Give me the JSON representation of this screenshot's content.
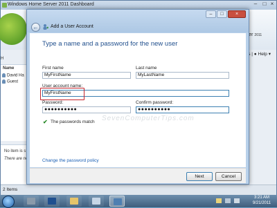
{
  "background_app": {
    "title": "Windows Home Server 2011 Dashboard",
    "home_label": "H",
    "brand": "e Server",
    "brand_suffix": "2011",
    "settings_label": "ngs",
    "help_label": "Help",
    "list_header": "Name",
    "users": [
      "David Ha",
      "Guest"
    ],
    "task_pane_line1": "No item is s",
    "task_pane_line2": "There are no",
    "status": "2 Items"
  },
  "dialog": {
    "title": "Add a User Account",
    "heading": "Type a name and a password for the new user",
    "first_name": {
      "label": "First name",
      "value": "MyFirstName"
    },
    "last_name": {
      "label": "Last name",
      "value": "MyLastName"
    },
    "user_account_name": {
      "label": "User account name:",
      "value": "MyFirstName"
    },
    "password": {
      "label": "Password:",
      "value": "●●●●●●●●●●"
    },
    "confirm_password": {
      "label": "Confirm password:",
      "value": "●●●●●●●●●●"
    },
    "password_status": "The passwords match",
    "policy_link": "Change the password policy",
    "watermark": "SevenComputerTips.com",
    "next_button": "Next",
    "cancel_button": "Cancel"
  },
  "taskbar": {
    "time": "3:21 AM",
    "date": "9/21/2011"
  },
  "colors": {
    "heading": "#1f4e8c",
    "link": "#1a5fb4",
    "highlight_border": "#c4232b",
    "check": "#2a8a2a"
  }
}
